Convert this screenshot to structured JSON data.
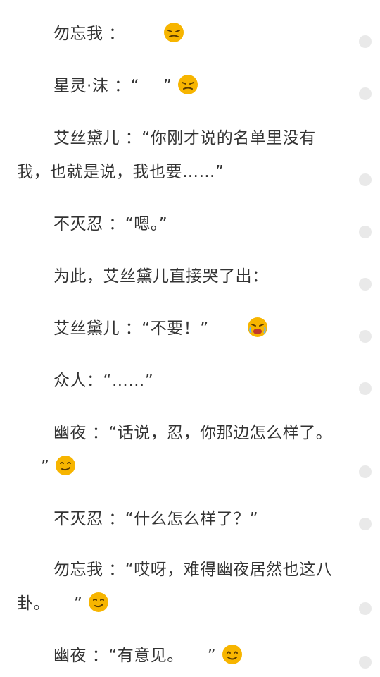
{
  "paragraphs": [
    {
      "text": "勿忘我 ：",
      "after": "",
      "emoji": "dizzy-face-icon"
    },
    {
      "text": "星灵·沫 ：“",
      "after": "”",
      "emoji": "dizzy-face-icon"
    },
    {
      "text": "艾丝黛儿 ：“你刚才说的名单里没有我，也就是说，我也要……”",
      "after": "",
      "emoji": ""
    },
    {
      "text": "不灭忍 ：“嗯。”",
      "after": "",
      "emoji": ""
    },
    {
      "text": "为此，艾丝黛儿直接哭了出：",
      "after": "",
      "emoji": ""
    },
    {
      "text": "艾丝黛儿 ：“不要！”",
      "after": "",
      "emoji": "crying-face-icon"
    },
    {
      "text": "众人：“……”",
      "after": "",
      "emoji": ""
    },
    {
      "text": "幽夜 ：“话说，忍，你那边怎么样了。",
      "after": "”",
      "emoji": "smirk-face-icon"
    },
    {
      "text": "不灭忍 ：“什么怎么样了？”",
      "after": "",
      "emoji": ""
    },
    {
      "text": "勿忘我 ：“哎呀，难得幽夜居然也这八卦。",
      "after": "”",
      "emoji": "smirk-face-icon"
    },
    {
      "text": "幽夜 ：“有意见。",
      "after": "”",
      "emoji": "smile-face-icon"
    }
  ],
  "colors": {
    "text": "#333333",
    "emoji": "#f7b500",
    "marker": "#e9e9e9"
  }
}
